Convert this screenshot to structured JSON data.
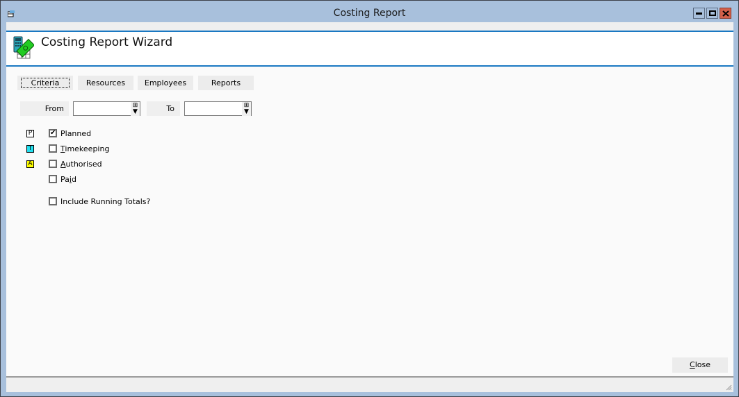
{
  "window": {
    "title": "Costing Report",
    "controls": {
      "minimize": "minimize",
      "maximize": "maximize",
      "close": "close"
    }
  },
  "header": {
    "title": "Costing Report Wizard",
    "icon": "calculator-money-icon"
  },
  "tabs": [
    {
      "label": "Criteria",
      "active": true
    },
    {
      "label": "Resources",
      "active": false
    },
    {
      "label": "Employees",
      "active": false
    },
    {
      "label": "Reports",
      "active": false
    }
  ],
  "date_range": {
    "from_label": "From",
    "from_value": "",
    "to_label": "To",
    "to_value": ""
  },
  "options": [
    {
      "legend": "P",
      "legend_color": "#ffffff",
      "label": "Planned",
      "checked": true,
      "mnemonic": ""
    },
    {
      "legend": "T",
      "legend_color": "#22e0f0",
      "label": "Timekeeping",
      "checked": false,
      "mnemonic": "T"
    },
    {
      "legend": "A",
      "legend_color": "#ffff00",
      "label": "Authorised",
      "checked": false,
      "mnemonic": "A"
    },
    {
      "legend": "",
      "legend_color": "",
      "label": "Paid",
      "checked": false,
      "mnemonic": "i"
    }
  ],
  "running_totals": {
    "label": "Include Running Totals?",
    "checked": false
  },
  "footer": {
    "close_label": "Close"
  },
  "colors": {
    "accent": "#1a78c2",
    "frame": "#a8c0dc",
    "close_button": "#d2604a"
  }
}
